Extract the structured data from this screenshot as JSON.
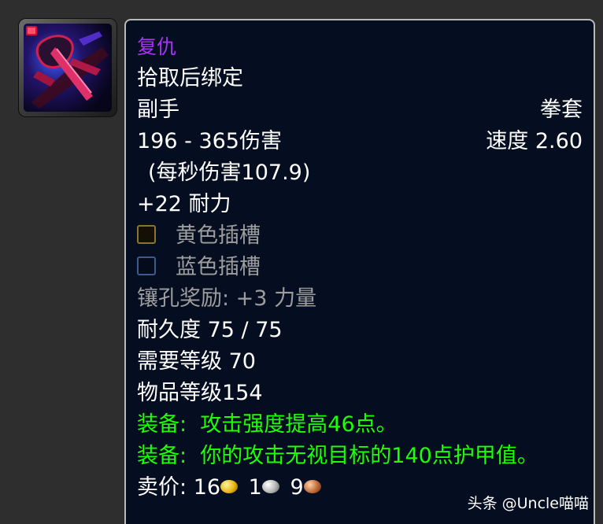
{
  "item": {
    "icon": "fist-weapon-icon",
    "name": "复仇",
    "binding": "拾取后绑定",
    "slot": "副手",
    "type": "拳套",
    "damage": "196 - 365伤害",
    "speed": "速度 2.60",
    "dps": "(每秒伤害107.9)",
    "stamina": "+22 耐力",
    "socket_yellow": "黄色插槽",
    "socket_blue": "蓝色插槽",
    "socket_bonus": "镶孔奖励: +3 力量",
    "durability": "耐久度 75 / 75",
    "required_level": "需要等级 70",
    "item_level": "物品等级154",
    "equip_1_label": "装备:",
    "equip_1": "攻击强度提高46点。",
    "equip_2_label": "装备:",
    "equip_2": "你的攻击无视目标的140点护甲值。",
    "sell_label": "卖价:",
    "sell_gold": "16",
    "sell_silver": "1",
    "sell_copper": "9"
  },
  "watermark": "头条 @Uncle喵喵",
  "colors": {
    "background": "#050d20",
    "name_epic": "#a335ee",
    "equip_green": "#1eff00",
    "disabled_gray": "#9d9d9d",
    "border": "#b9b9b9"
  }
}
